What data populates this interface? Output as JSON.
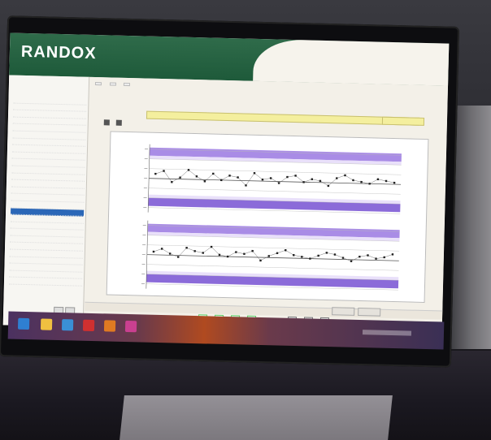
{
  "app": {
    "logo": "RANDOX"
  },
  "badge": {
    "left": "",
    "right": ""
  },
  "sidebar": {
    "heading": "",
    "items": [
      {
        "label": "",
        "selected": false
      },
      {
        "label": "",
        "selected": false
      },
      {
        "label": "",
        "selected": false
      },
      {
        "label": "",
        "selected": false
      },
      {
        "label": "",
        "selected": false
      },
      {
        "label": "",
        "selected": false
      },
      {
        "label": "",
        "selected": false
      },
      {
        "label": "",
        "selected": false
      },
      {
        "label": "",
        "selected": false
      },
      {
        "label": "",
        "selected": false
      },
      {
        "label": "",
        "selected": false
      },
      {
        "label": "",
        "selected": false
      },
      {
        "label": "",
        "selected": false
      },
      {
        "label": "",
        "selected": false
      },
      {
        "label": "",
        "selected": false
      },
      {
        "label": "",
        "selected": false
      },
      {
        "label": "",
        "selected": true
      },
      {
        "label": "",
        "selected": false
      },
      {
        "label": "",
        "selected": false
      },
      {
        "label": "",
        "selected": false
      },
      {
        "label": "",
        "selected": false
      },
      {
        "label": "",
        "selected": false
      },
      {
        "label": "",
        "selected": false
      },
      {
        "label": "",
        "selected": false
      },
      {
        "label": "",
        "selected": false
      },
      {
        "label": "",
        "selected": false
      },
      {
        "label": "",
        "selected": false
      }
    ],
    "footer": ""
  },
  "main": {
    "tabs": [
      "",
      "",
      ""
    ],
    "info_line_1": "",
    "info_line_2": "",
    "highlight": ""
  },
  "chart_data": [
    {
      "type": "scatter",
      "title": "",
      "series": [
        {
          "values": [
            0.3,
            0.5,
            -0.2,
            0.1,
            0.6,
            0.2,
            -0.1,
            0.4,
            0.0,
            0.3,
            0.2,
            -0.3,
            0.5,
            0.1,
            0.2,
            -0.1,
            0.3,
            0.4,
            0.0,
            0.2,
            0.1,
            -0.2,
            0.3,
            0.5,
            0.2,
            0.1,
            0.0,
            0.3,
            0.2,
            0.1
          ]
        }
      ]
    },
    {
      "type": "scatter",
      "title": "",
      "series": [
        {
          "values": [
            0.2,
            0.4,
            0.1,
            -0.1,
            0.5,
            0.3,
            0.2,
            0.6,
            0.1,
            0.0,
            0.3,
            0.2,
            0.4,
            -0.2,
            0.1,
            0.3,
            0.5,
            0.2,
            0.1,
            0.0,
            0.2,
            0.4,
            0.3,
            0.1,
            -0.1,
            0.2,
            0.3,
            0.1,
            0.2,
            0.4
          ]
        }
      ]
    }
  ],
  "colors": {
    "band": "#a98ce6",
    "band_dark": "#8b6bd9",
    "header": "#2f6b4a",
    "accent": "#f08a2a",
    "selection": "#2b67b7"
  }
}
